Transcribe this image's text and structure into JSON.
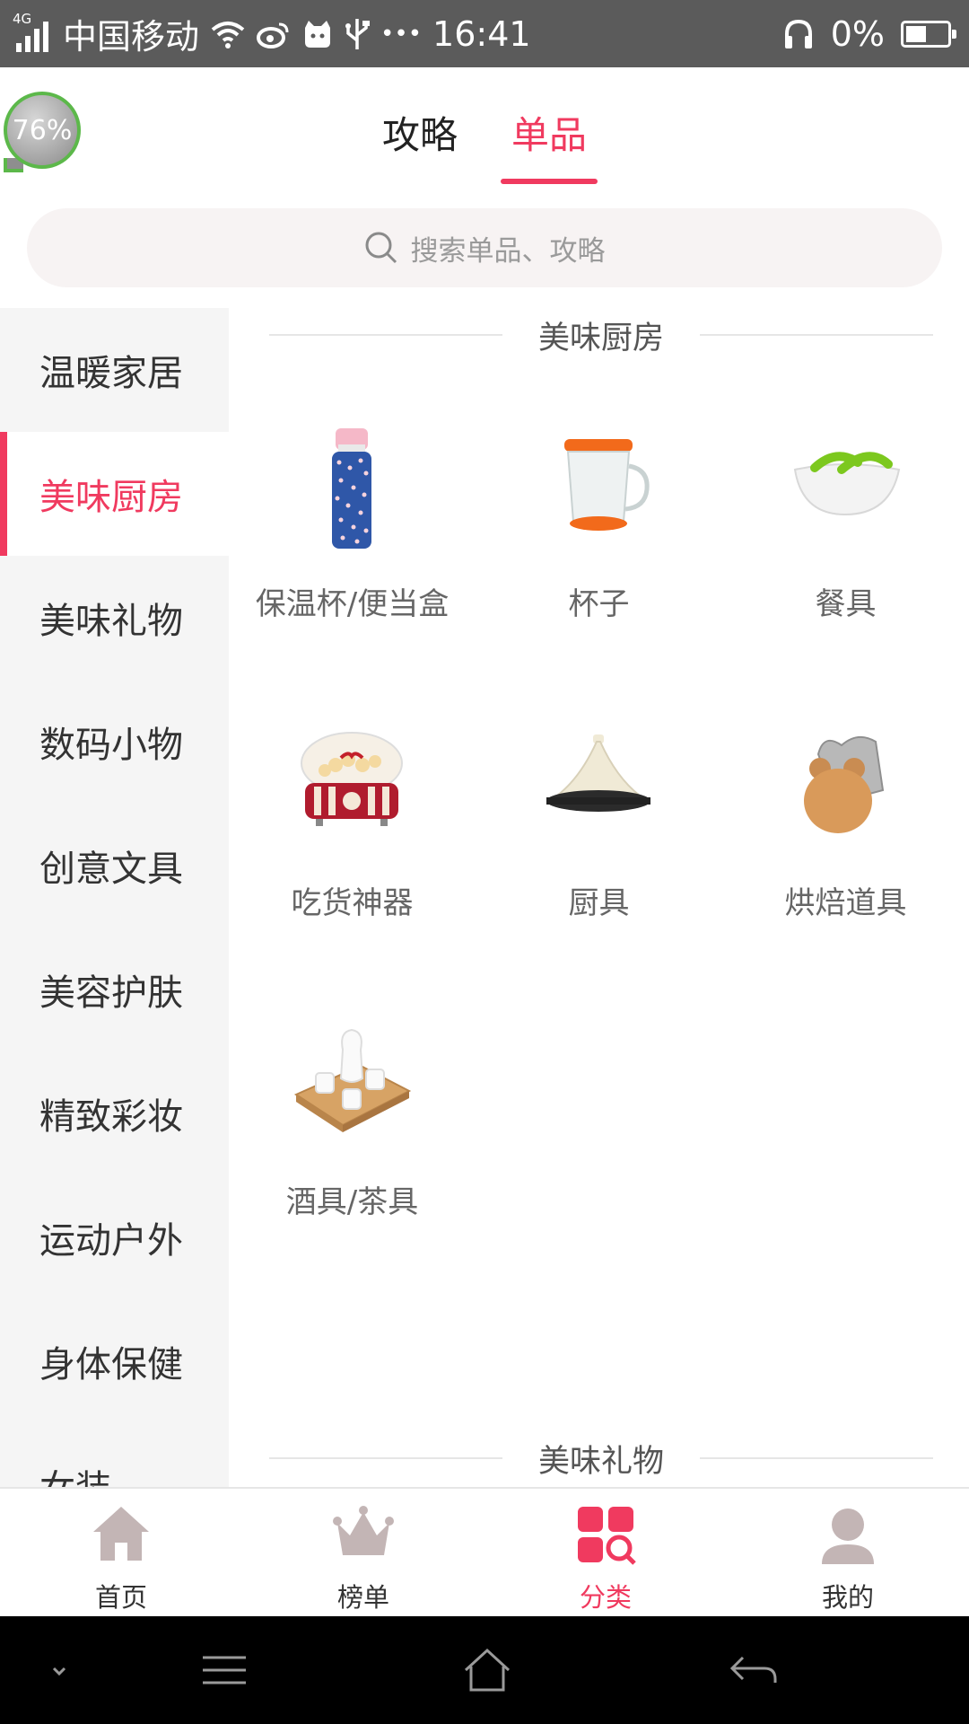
{
  "status_bar": {
    "network_type": "4G",
    "carrier": "中国移动",
    "time": "16:41",
    "battery": "0%",
    "dots": "•••"
  },
  "floating_bubble": {
    "text": "76%"
  },
  "top_tabs": [
    {
      "label": "攻略",
      "active": false
    },
    {
      "label": "单品",
      "active": true
    }
  ],
  "search": {
    "placeholder": "搜索单品、攻略"
  },
  "sidebar": {
    "items": [
      {
        "label": "温暖家居",
        "active": false
      },
      {
        "label": "美味厨房",
        "active": true
      },
      {
        "label": "美味礼物",
        "active": false
      },
      {
        "label": "数码小物",
        "active": false
      },
      {
        "label": "创意文具",
        "active": false
      },
      {
        "label": "美容护肤",
        "active": false
      },
      {
        "label": "精致彩妆",
        "active": false
      },
      {
        "label": "运动户外",
        "active": false
      },
      {
        "label": "身体保健",
        "active": false
      },
      {
        "label": "女装",
        "active": false
      }
    ]
  },
  "content": {
    "sections": [
      {
        "title": "美味厨房",
        "items": [
          {
            "label": "保温杯/便当盒",
            "icon": "thermos-bottle-image"
          },
          {
            "label": "杯子",
            "icon": "glass-mug-image"
          },
          {
            "label": "餐具",
            "icon": "salad-bowl-image"
          },
          {
            "label": "吃货神器",
            "icon": "popcorn-maker-image"
          },
          {
            "label": "厨具",
            "icon": "tagine-pot-image"
          },
          {
            "label": "烘焙道具",
            "icon": "baking-mold-image"
          },
          {
            "label": "酒具/茶具",
            "icon": "tea-set-image"
          }
        ]
      },
      {
        "title": "美味礼物",
        "items": []
      }
    ]
  },
  "bottom_nav": [
    {
      "label": "首页",
      "icon": "home-icon",
      "active": false
    },
    {
      "label": "榜单",
      "icon": "crown-icon",
      "active": false
    },
    {
      "label": "分类",
      "icon": "category-search-icon",
      "active": true
    },
    {
      "label": "我的",
      "icon": "profile-icon",
      "active": false
    }
  ],
  "colors": {
    "accent": "#f03a5f",
    "sidebar_bg": "#f5f5f5",
    "icon_gray": "#c3b5b5"
  }
}
